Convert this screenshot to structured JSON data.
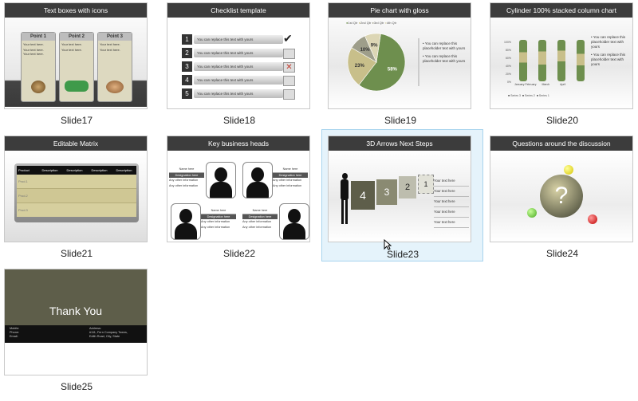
{
  "slides": [
    {
      "caption": "Slide17",
      "title": "Text boxes with icons",
      "points": [
        "Point 1",
        "Point 2",
        "Point 3"
      ],
      "body_text": "Your text here."
    },
    {
      "caption": "Slide18",
      "title": "Checklist template",
      "items": [
        "You can replace this text with yours",
        "You can replace this text with yours",
        "You can replace this text with yours",
        "You can replace this text with yours",
        "You can replace this text with yours"
      ],
      "numbers": [
        "1",
        "2",
        "3",
        "4",
        "5"
      ]
    },
    {
      "caption": "Slide19",
      "title": "Pie chart with gloss",
      "legend": [
        "1st Qtr",
        "2nd Qtr",
        "3rd Qtr",
        "4th Qtr"
      ],
      "bullet_text": "You can replace this placeholder text with yours"
    },
    {
      "caption": "Slide20",
      "title": "Cylinder 100% stacked column chart",
      "y_ticks": [
        "100%",
        "80%",
        "60%",
        "40%",
        "20%",
        "0%"
      ],
      "x_labels": [
        "January",
        "February",
        "March",
        "April"
      ],
      "legend": [
        "Series 3",
        "Series 2",
        "Series 1"
      ],
      "bullet_text": "You can replace this placeholder text with yours"
    },
    {
      "caption": "Slide21",
      "title": "Editable Matrix",
      "headers": [
        "Product",
        "Description",
        "Description",
        "Description",
        "Description"
      ],
      "rows": [
        "Prod.1",
        "Prod.2",
        "Prod.3"
      ]
    },
    {
      "caption": "Slide22",
      "title": "Key business heads",
      "name_label": "Name here",
      "designation_label": "Designation here",
      "info_label": "Any other information"
    },
    {
      "caption": "Slide23",
      "title": "3D Arrows Next Steps",
      "steps": [
        "4",
        "3",
        "2",
        "1"
      ],
      "text": "Your text here"
    },
    {
      "caption": "Slide24",
      "title": "Questions around the discussion",
      "symbol": "?"
    },
    {
      "caption": "Slide25",
      "title": "Thank You",
      "contact_left": [
        "Mobile:",
        "Phone:",
        "Email:"
      ],
      "contact_right": [
        "Address:",
        "#111, Fern Company Towns,",
        "Edith Road, City, State"
      ]
    }
  ],
  "pie_chart": {
    "chart_data": {
      "type": "pie",
      "categories": [
        "1st Qtr",
        "2nd Qtr",
        "3rd Qtr",
        "4th Qtr"
      ],
      "values": [
        58,
        23,
        10,
        9
      ],
      "labels": [
        "58%",
        "23%",
        "10%",
        "9%"
      ]
    }
  },
  "colors": {
    "title_bar": "#3c3c3c",
    "olive": "#6b6b53",
    "khaki": "#cbc393",
    "selection": "#e5f3fb"
  }
}
